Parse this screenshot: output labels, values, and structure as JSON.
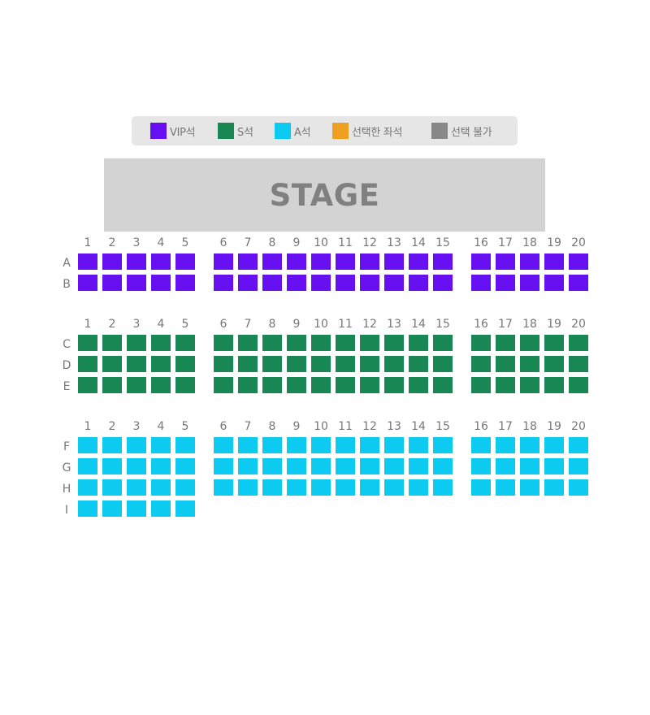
{
  "legend": [
    {
      "label": "VIP석",
      "color": "#6610f2",
      "icon": "vip-seat-swatch"
    },
    {
      "label": "S석",
      "color": "#198754",
      "icon": "s-seat-swatch"
    },
    {
      "label": "A석",
      "color": "#0dcaf0",
      "icon": "a-seat-swatch"
    },
    {
      "label": "선택한 좌석",
      "color": "#f0a020",
      "icon": "selected-seat-swatch"
    },
    {
      "label": "선택 불가",
      "color": "#888888",
      "icon": "unavailable-seat-swatch"
    }
  ],
  "stage": {
    "label": "STAGE"
  },
  "column_numbers": [
    "1",
    "2",
    "3",
    "4",
    "5",
    "6",
    "7",
    "8",
    "9",
    "10",
    "11",
    "12",
    "13",
    "14",
    "15",
    "16",
    "17",
    "18",
    "19",
    "20"
  ],
  "sections": [
    {
      "name": "VIP석",
      "color": "#6610f2",
      "rows": [
        {
          "label": "A",
          "seat_count": 20
        },
        {
          "label": "B",
          "seat_count": 20
        }
      ]
    },
    {
      "name": "S석",
      "color": "#198754",
      "rows": [
        {
          "label": "C",
          "seat_count": 20
        },
        {
          "label": "D",
          "seat_count": 20
        },
        {
          "label": "E",
          "seat_count": 20
        }
      ]
    },
    {
      "name": "A석",
      "color": "#0dcaf0",
      "rows": [
        {
          "label": "F",
          "seat_count": 20
        },
        {
          "label": "G",
          "seat_count": 20
        },
        {
          "label": "H",
          "seat_count": 20
        },
        {
          "label": "I",
          "seat_count": 5
        }
      ]
    }
  ]
}
